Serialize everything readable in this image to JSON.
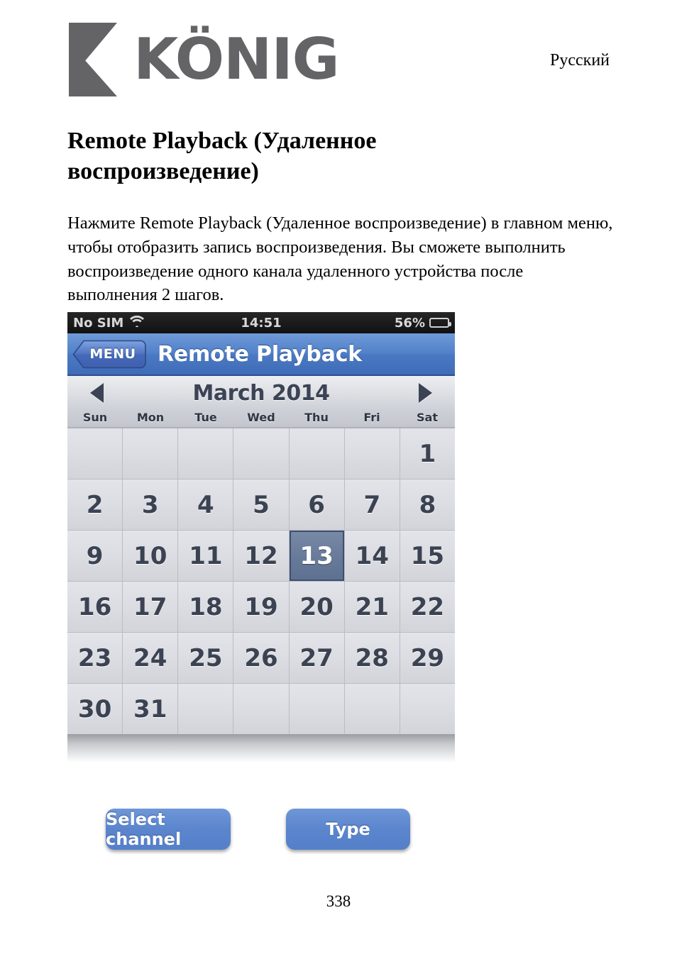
{
  "header": {
    "brand": "KÖNIG",
    "language": "Русский"
  },
  "document": {
    "title": "Remote Playback (Удаленное воспроизведение)",
    "paragraph": "Нажмите Remote Playback (Удаленное воспроизведение) в главном меню, чтобы отобразить запись воспроизведения. Вы сможете выполнить воспроизведение одного канала удаленного устройства после выполнения 2 шагов.",
    "page_number": "338"
  },
  "phone": {
    "status_bar": {
      "carrier": "No SIM",
      "wifi_icon": "wifi-icon",
      "time": "14:51",
      "battery_percent": "56%",
      "battery_level": 56
    },
    "nav_bar": {
      "back_label": "MENU",
      "title": "Remote Playback"
    },
    "calendar": {
      "prev_icon": "chevron-left-icon",
      "next_icon": "chevron-right-icon",
      "month_label": "March 2014",
      "weekdays": [
        "Sun",
        "Mon",
        "Tue",
        "Wed",
        "Thu",
        "Fri",
        "Sat"
      ],
      "selected_day": 13,
      "cells": [
        "",
        "",
        "",
        "",
        "",
        "",
        "1",
        "2",
        "3",
        "4",
        "5",
        "6",
        "7",
        "8",
        "9",
        "10",
        "11",
        "12",
        "13",
        "14",
        "15",
        "16",
        "17",
        "18",
        "19",
        "20",
        "21",
        "22",
        "23",
        "24",
        "25",
        "26",
        "27",
        "28",
        "29",
        "30",
        "31",
        "",
        "",
        "",
        "",
        ""
      ]
    }
  },
  "buttons": {
    "select_channel": "Select channel",
    "type": "Type"
  },
  "colors": {
    "nav_blue": "#4a79c2",
    "button_blue": "#5b85cd",
    "selected_day": "#687a99",
    "logo_gray": "#646466"
  }
}
